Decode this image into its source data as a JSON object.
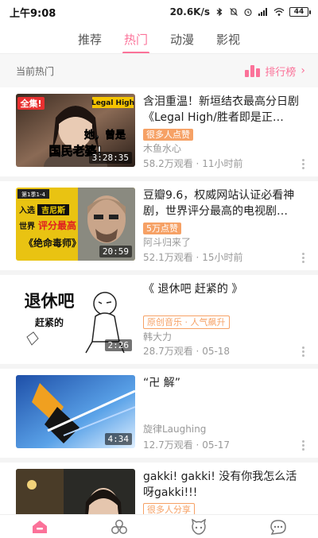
{
  "status_bar": {
    "time": "上午9:08",
    "speed": "20.6K/s",
    "battery": "44",
    "icons": [
      "bluetooth-icon",
      "mute-icon",
      "alarm-icon",
      "hd-signal-icon",
      "wifi-icon",
      "battery-icon"
    ]
  },
  "tabs": [
    {
      "label": "推荐",
      "active": false
    },
    {
      "label": "热门",
      "active": true
    },
    {
      "label": "动漫",
      "active": false
    },
    {
      "label": "影视",
      "active": false
    }
  ],
  "section": {
    "title": "当前热门",
    "ranking_label": "排行榜",
    "ranking_icon": "ranking-bars-icon",
    "chevron_icon": "chevron-right-icon"
  },
  "videos": [
    {
      "title": "含泪重温！新垣结衣最高分日剧《Legal High/胜者即是正义》...",
      "badge": "很多人点赞",
      "badge_style": "fill",
      "author": "木鱼水心",
      "views": "58.2万观看",
      "time": "11小时前",
      "duration": "3:28:35",
      "thumb_texts": [
        "全集!",
        "Legal High",
        "她，曾是",
        "国民老婆!"
      ]
    },
    {
      "title": "豆瓣9.6，权威网站认证必看神剧，世界评分最高的电视剧《绝...",
      "badge": "5万点赞",
      "badge_style": "fill",
      "author": "阿斗归来了",
      "views": "52.1万观看",
      "time": "15小时前",
      "duration": "20:59",
      "thumb_texts": [
        "第1季1-4",
        "入选",
        "吉尼斯",
        "世界",
        "评分最高",
        "《绝命毒师》"
      ]
    },
    {
      "title": "《 退休吧  赶紧的 》",
      "badge": "原创音乐 · 人气飙升",
      "badge_style": "outline",
      "author": "韩大力",
      "views": "28.7万观看",
      "time": "05-18",
      "duration": "2:26",
      "thumb_texts": [
        "退休吧",
        "赶紧的"
      ]
    },
    {
      "title": "“卍 解”",
      "badge": "",
      "badge_style": "none",
      "author": "旋律Laughing",
      "views": "12.7万观看",
      "time": "05-17",
      "duration": "4:34",
      "thumb_texts": []
    },
    {
      "title": "gakki! gakki! 没有你我怎么活呀gakki!!!",
      "badge": "很多人分享",
      "badge_style": "outline",
      "author": "",
      "views": "",
      "time": "",
      "duration": "",
      "thumb_texts": []
    }
  ],
  "meta_separator": " · ",
  "bottom_nav": [
    {
      "name": "home-icon",
      "active": true
    },
    {
      "name": "channels-icon",
      "active": false
    },
    {
      "name": "dynamic-icon",
      "active": false
    },
    {
      "name": "messages-icon",
      "active": false
    }
  ],
  "colors": {
    "accent": "#fb7299",
    "badge": "#f6a165",
    "muted": "#999999"
  }
}
